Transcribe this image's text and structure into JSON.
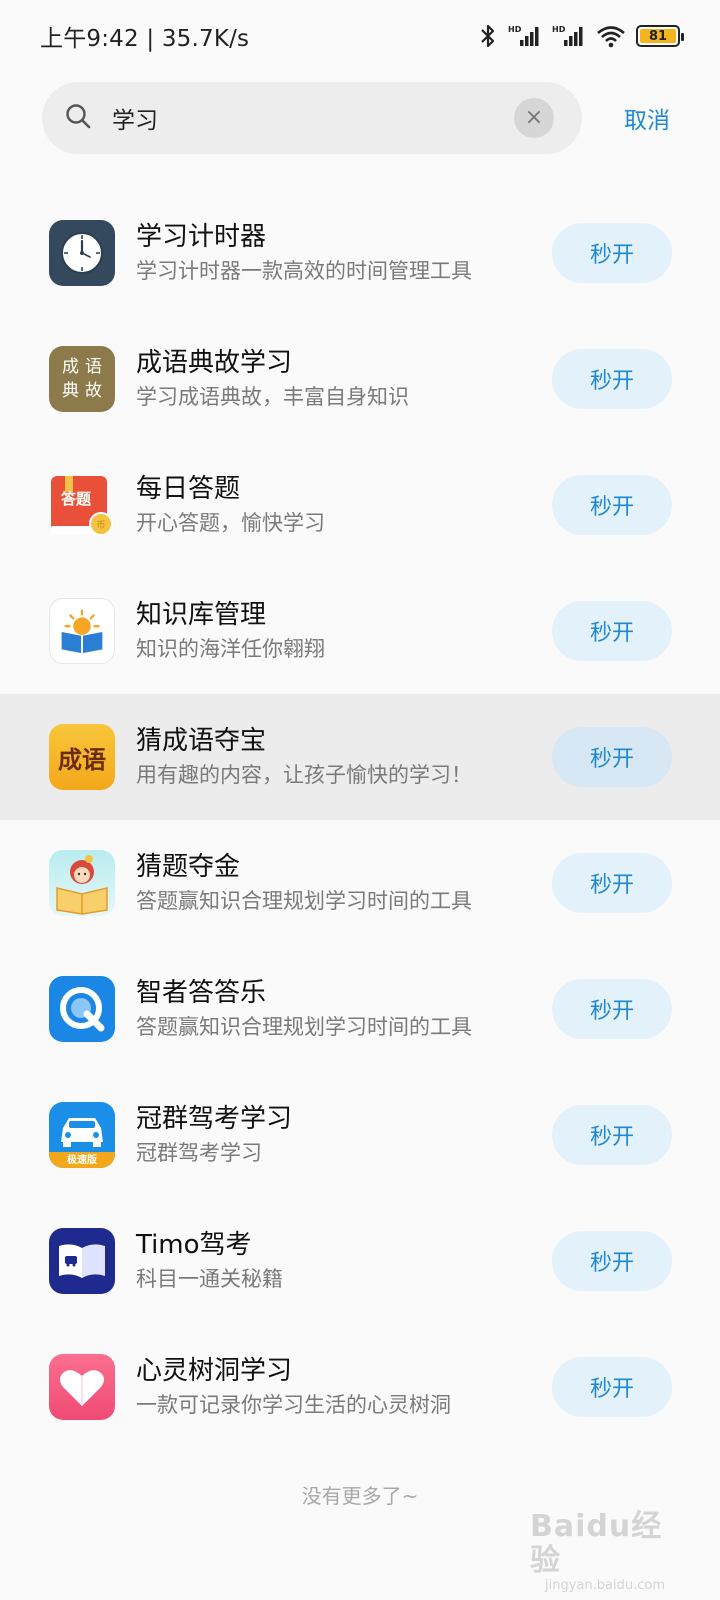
{
  "status_bar": {
    "time": "上午9:42 | 35.7K/s",
    "battery": "81",
    "icons": [
      "bluetooth-icon",
      "hd-signal-icon",
      "hd-signal-icon",
      "wifi-icon",
      "battery-icon"
    ]
  },
  "search": {
    "value": "学习",
    "clear_label": "×",
    "cancel_label": "取消"
  },
  "apps": [
    {
      "name": "学习计时器",
      "desc": "学习计时器一款高效的时间管理工具",
      "button": "秒开",
      "icon": "clock-icon"
    },
    {
      "name": "成语典故学习",
      "desc": "学习成语典故，丰富自身知识",
      "button": "秒开",
      "icon": "idiom-book-icon",
      "icon_text": [
        "成语",
        "典故"
      ]
    },
    {
      "name": "每日答题",
      "desc": "开心答题，愉快学习",
      "button": "秒开",
      "icon": "quiz-book-icon",
      "icon_text": "答题"
    },
    {
      "name": "知识库管理",
      "desc": "知识的海洋任你翱翔",
      "button": "秒开",
      "icon": "sunrise-book-icon"
    },
    {
      "name": "猜成语夺宝",
      "desc": "用有趣的内容，让孩子愉快的学习！",
      "button": "秒开",
      "icon": "idiom-treasure-icon",
      "icon_text": "成语"
    },
    {
      "name": "猜题夺金",
      "desc": "答题赢知识合理规划学习时间的工具",
      "button": "秒开",
      "icon": "reading-girl-icon"
    },
    {
      "name": "智者答答乐",
      "desc": "答题赢知识合理规划学习时间的工具",
      "button": "秒开",
      "icon": "q-pen-icon"
    },
    {
      "name": "冠群驾考学习",
      "desc": "冠群驾考学习",
      "button": "秒开",
      "icon": "car-icon",
      "icon_text": "极速版"
    },
    {
      "name": "Timo驾考",
      "desc": "科目一通关秘籍",
      "button": "秒开",
      "icon": "open-book-car-icon"
    },
    {
      "name": "心灵树洞学习",
      "desc": "一款可记录你学习生活的心灵树洞",
      "button": "秒开",
      "icon": "heart-icon"
    }
  ],
  "highlighted_index": 4,
  "footer": {
    "no_more": "没有更多了~",
    "watermark": "Baidu经验",
    "watermark_sub": "jingyan.baidu.com"
  }
}
